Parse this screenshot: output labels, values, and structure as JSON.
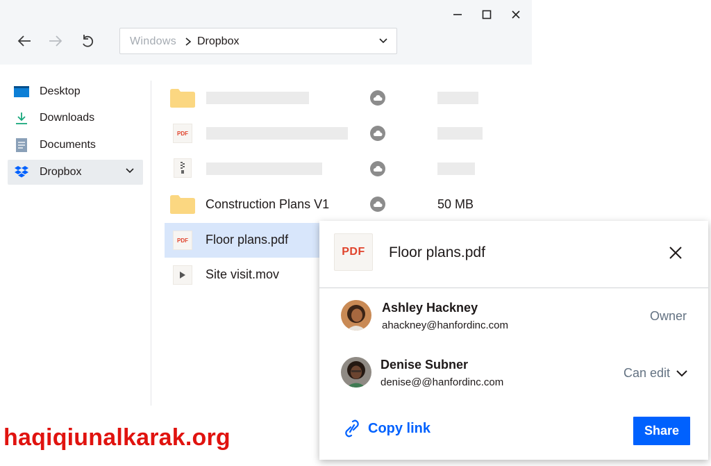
{
  "window": {
    "controls": [
      "minimize-icon",
      "maximize-icon",
      "close-icon"
    ]
  },
  "nav": {
    "back_icon": "arrow-left-icon",
    "forward_icon": "arrow-right-icon",
    "refresh_icon": "refresh-icon"
  },
  "address": {
    "parent": "Windows",
    "current": "Dropbox"
  },
  "sidebar": {
    "items": [
      {
        "label": "Desktop",
        "icon": "desktop-icon"
      },
      {
        "label": "Downloads",
        "icon": "download-icon"
      },
      {
        "label": "Documents",
        "icon": "document-icon"
      },
      {
        "label": "Dropbox",
        "icon": "dropbox-icon",
        "active": true
      }
    ]
  },
  "files": {
    "items": [
      {
        "name": "Construction Plans V1",
        "size": "50 MB",
        "type": "folder"
      },
      {
        "name": "Floor plans.pdf",
        "type": "pdf",
        "selected": true
      },
      {
        "name": "Site visit.mov",
        "type": "video"
      }
    ],
    "pdf_badge": "PDF"
  },
  "share": {
    "file_badge": "PDF",
    "file_name": "Floor plans.pdf",
    "members": [
      {
        "name": "Ashley Hackney",
        "email": "ahackney@hanfordinc.com",
        "role": "Owner"
      },
      {
        "name": "Denise Subner",
        "email": "denise@@hanfordinc.com",
        "role": "Can edit"
      }
    ],
    "copy_link": "Copy link",
    "share_button": "Share"
  },
  "watermark": "haqiqiunalkarak.org",
  "colors": {
    "accent": "#0061fe",
    "pdf_red": "#e0432c",
    "folder": "#fbd781",
    "watermark": "#e0130f"
  }
}
